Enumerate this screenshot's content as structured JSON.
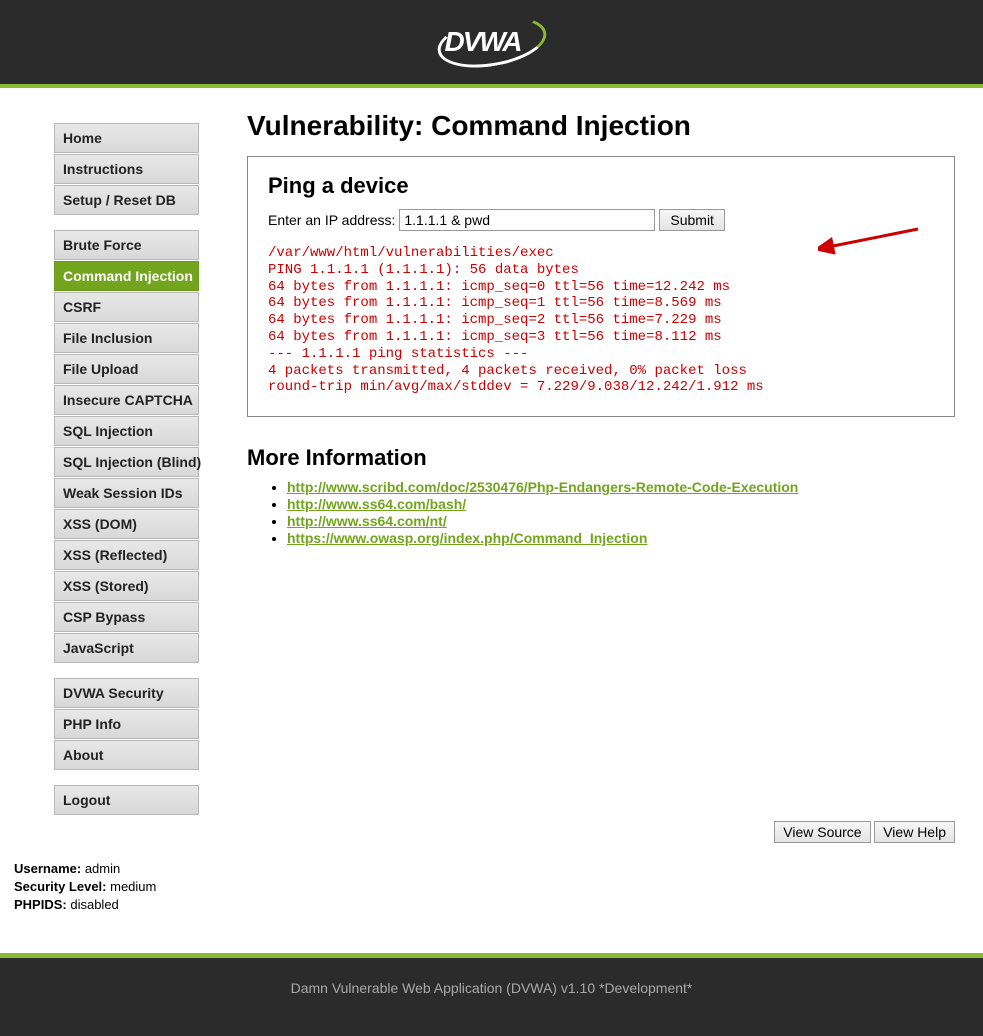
{
  "header": {
    "logo_text": "DVWA"
  },
  "sidebar": {
    "group1": [
      "Home",
      "Instructions",
      "Setup / Reset DB"
    ],
    "group2": [
      "Brute Force",
      "Command Injection",
      "CSRF",
      "File Inclusion",
      "File Upload",
      "Insecure CAPTCHA",
      "SQL Injection",
      "SQL Injection (Blind)",
      "Weak Session IDs",
      "XSS (DOM)",
      "XSS (Reflected)",
      "XSS (Stored)",
      "CSP Bypass",
      "JavaScript"
    ],
    "group2_selected_index": 1,
    "group3": [
      "DVWA Security",
      "PHP Info",
      "About"
    ],
    "group4": [
      "Logout"
    ]
  },
  "status": {
    "username_label": "Username:",
    "username_value": " admin",
    "seclevel_label": "Security Level:",
    "seclevel_value": " medium",
    "phpids_label": "PHPIDS:",
    "phpids_value": " disabled"
  },
  "main": {
    "title": "Vulnerability: Command Injection",
    "form_title": "Ping a device",
    "ip_label": "Enter an IP address:",
    "ip_value": "1.1.1.1 & pwd",
    "submit_label": "Submit",
    "output": "/var/www/html/vulnerabilities/exec\nPING 1.1.1.1 (1.1.1.1): 56 data bytes\n64 bytes from 1.1.1.1: icmp_seq=0 ttl=56 time=12.242 ms\n64 bytes from 1.1.1.1: icmp_seq=1 ttl=56 time=8.569 ms\n64 bytes from 1.1.1.1: icmp_seq=2 ttl=56 time=7.229 ms\n64 bytes from 1.1.1.1: icmp_seq=3 ttl=56 time=8.112 ms\n--- 1.1.1.1 ping statistics ---\n4 packets transmitted, 4 packets received, 0% packet loss\nround-trip min/avg/max/stddev = 7.229/9.038/12.242/1.912 ms",
    "more_info_title": "More Information",
    "links": [
      "http://www.scribd.com/doc/2530476/Php-Endangers-Remote-Code-Execution",
      "http://www.ss64.com/bash/",
      "http://www.ss64.com/nt/",
      "https://www.owasp.org/index.php/Command_Injection"
    ],
    "view_source_label": "View Source",
    "view_help_label": "View Help"
  },
  "footer": {
    "text": "Damn Vulnerable Web Application (DVWA) v1.10 *Development*"
  },
  "colors": {
    "accent": "#8ab833",
    "header_bg": "#2b2b2b",
    "output_red": "#cc0000"
  }
}
